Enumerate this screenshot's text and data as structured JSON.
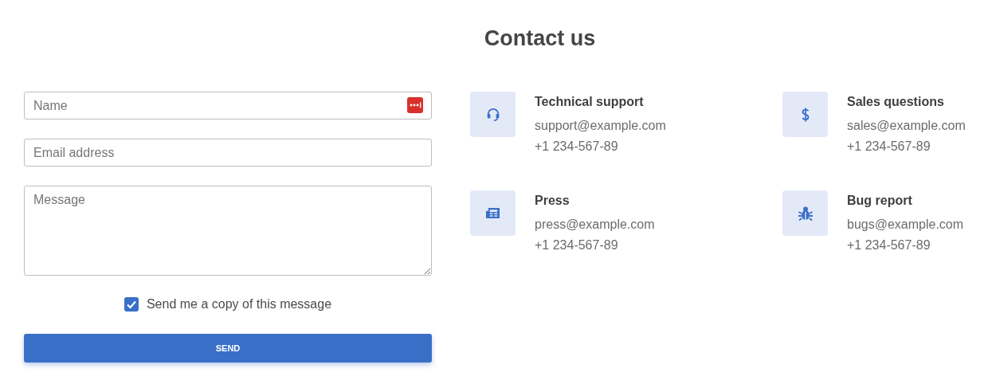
{
  "title": "Contact us",
  "form": {
    "fields": [
      {
        "kind": "input",
        "placeholder": "Name",
        "password_manager": true
      },
      {
        "kind": "input",
        "placeholder": "Email address",
        "password_manager": false
      },
      {
        "kind": "textarea",
        "placeholder": "Message",
        "password_manager": false
      }
    ],
    "copy_checkbox": {
      "label": "Send me a copy of this message",
      "checked": true
    },
    "submit": "SEND"
  },
  "contacts": [
    {
      "kind": "headset",
      "title": "Technical support",
      "email": "support@example.com",
      "phone": "+1 234-567-89"
    },
    {
      "kind": "dollar",
      "title": "Sales questions",
      "email": "sales@example.com",
      "phone": "+1 234-567-89"
    },
    {
      "kind": "newspaper",
      "title": "Press",
      "email": "press@example.com",
      "phone": "+1 234-567-89"
    },
    {
      "kind": "bug",
      "title": "Bug report",
      "email": "bugs@example.com",
      "phone": "+1 234-567-89"
    }
  ]
}
